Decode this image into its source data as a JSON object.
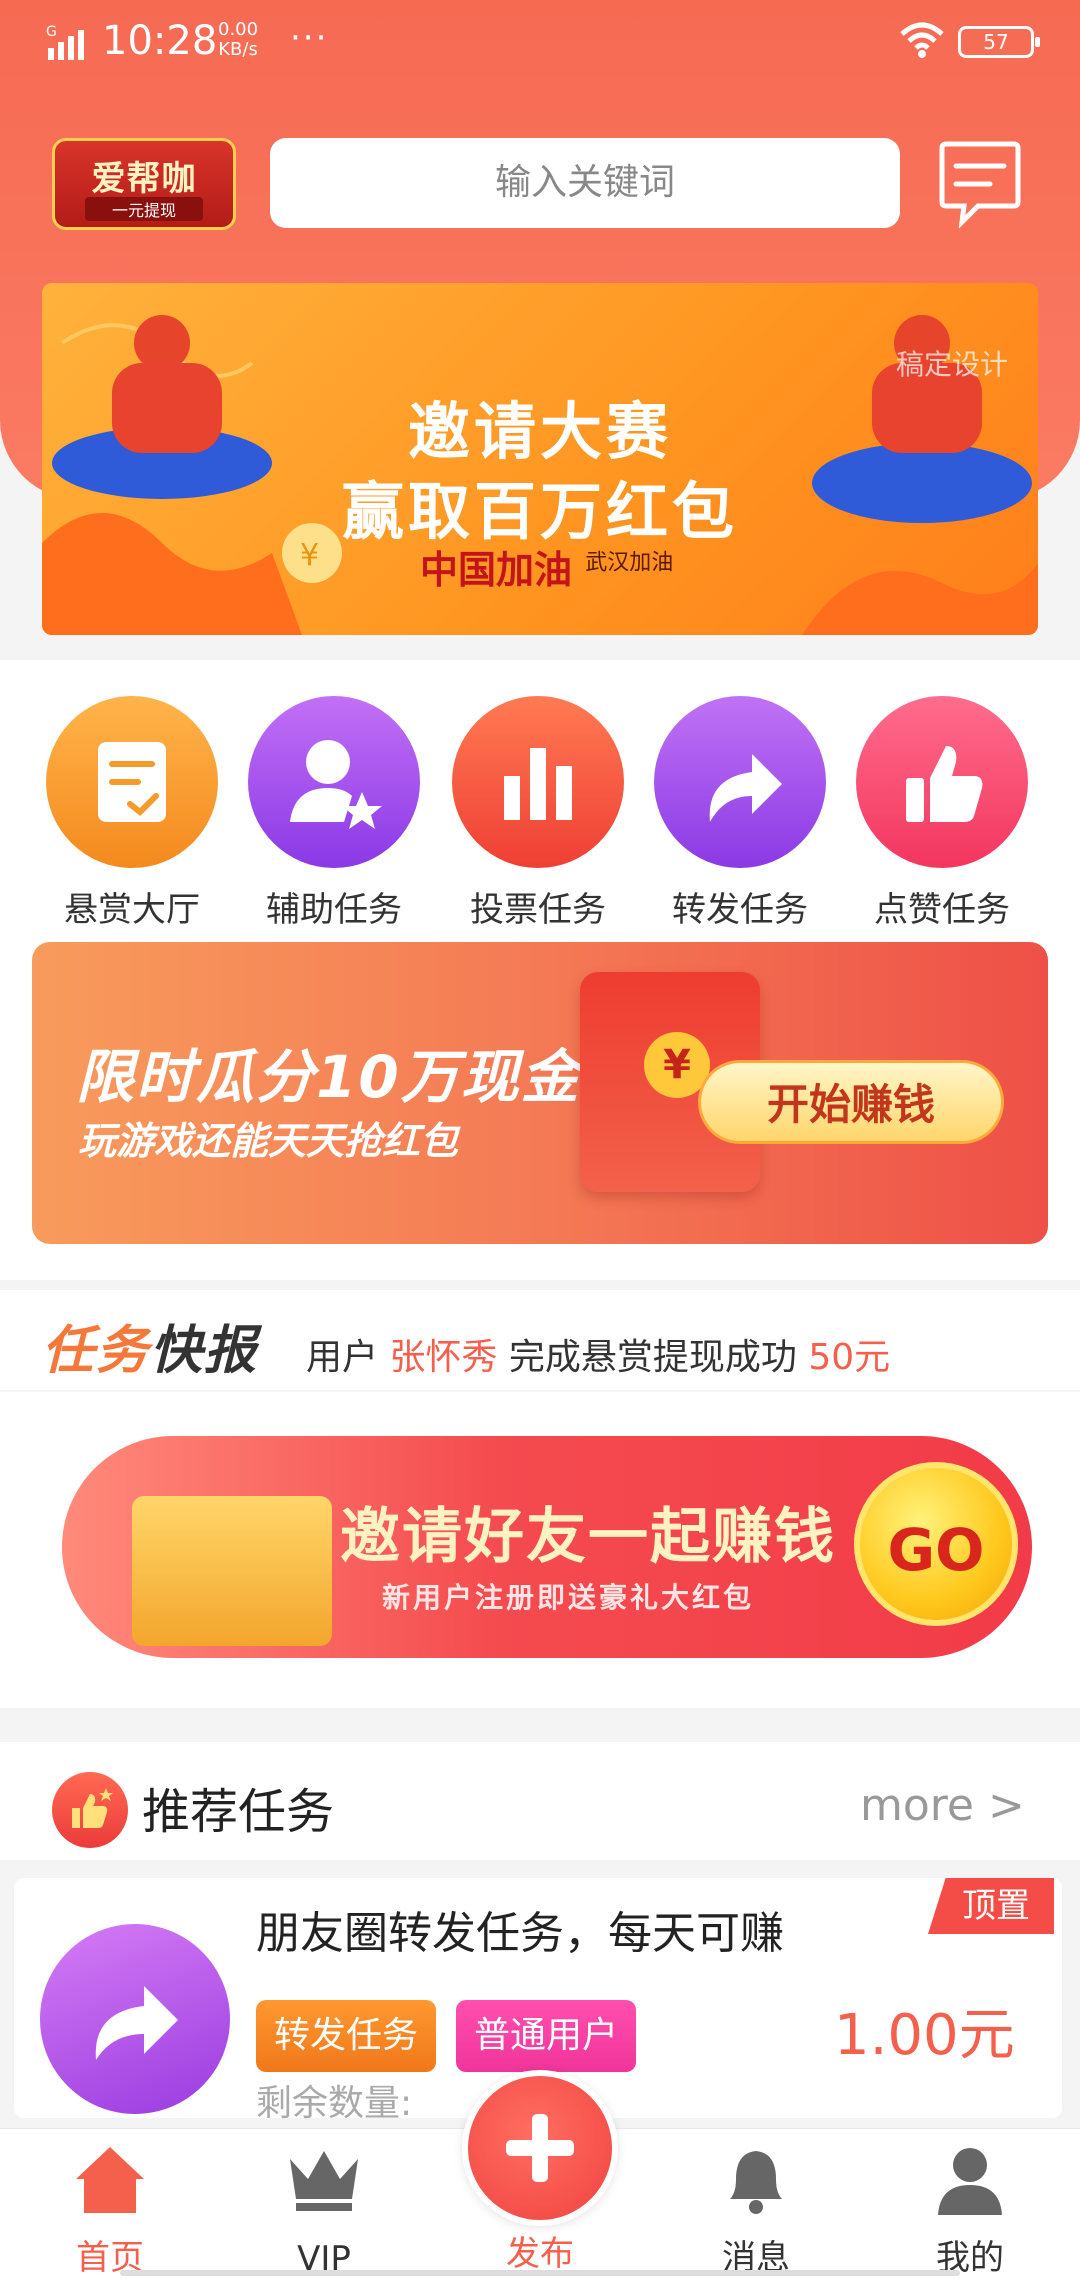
{
  "status_bar": {
    "network": "G",
    "time": "10:28",
    "speed_value": "0.00",
    "speed_unit": "KB/s",
    "dots": "···",
    "battery": "57"
  },
  "header": {
    "logo_text": "爱帮咖",
    "logo_sub": "一元提现",
    "search_placeholder": "输入关键词",
    "message_icon": "chat-bubble-icon"
  },
  "banner": {
    "line1": "邀请大赛",
    "line2": "赢取百万红包",
    "sub_main": "中国加油",
    "sub_small": "武汉加油",
    "watermark": "稿定设计"
  },
  "categories": [
    {
      "label": "悬赏大厅",
      "icon": "task-board-icon",
      "color_from": "#ffb44b",
      "color_to": "#f48a1e"
    },
    {
      "label": "辅助任务",
      "icon": "user-star-icon",
      "color_from": "#c270f5",
      "color_to": "#8a39e6"
    },
    {
      "label": "投票任务",
      "icon": "bar-chart-icon",
      "color_from": "#ff7a52",
      "color_to": "#ef3f35"
    },
    {
      "label": "转发任务",
      "icon": "share-arrow-icon",
      "color_from": "#c072f5",
      "color_to": "#8b3ae4"
    },
    {
      "label": "点赞任务",
      "icon": "thumbs-up-icon",
      "color_from": "#ff6c8c",
      "color_to": "#f3365f"
    }
  ],
  "promo1": {
    "title": "限时瓜分10万现金",
    "subtitle": "玩游戏还能天天抢红包",
    "button": "开始赚钱",
    "coin": "¥"
  },
  "ticker": {
    "logo_a": "任务",
    "logo_b": "快报",
    "prefix": "用户 ",
    "user": "张怀秀",
    "middle": " 完成悬赏提现成功 ",
    "amount": "50元"
  },
  "promo2": {
    "title": "邀请好友一起赚钱",
    "subtitle": "新用户注册即送豪礼大红包",
    "button": "GO"
  },
  "recommended": {
    "title": "推荐任务",
    "more": "more >"
  },
  "task_card": {
    "title": "朋友圈转发任务，每天可赚",
    "badge": "顶置",
    "tag1": "转发任务",
    "tag2": "普通用户",
    "price": "1.00元",
    "remain_label": "剩余数量:"
  },
  "bottom_nav": [
    {
      "label": "首页",
      "icon": "home-icon",
      "active": true
    },
    {
      "label": "VIP",
      "icon": "crown-icon",
      "active": false
    },
    {
      "label": "发布",
      "icon": "plus-icon",
      "active": true
    },
    {
      "label": "消息",
      "icon": "bell-icon",
      "active": false
    },
    {
      "label": "我的",
      "icon": "person-icon",
      "active": false
    }
  ],
  "colors": {
    "primary": "#f4604b",
    "header": "#f66a52"
  }
}
